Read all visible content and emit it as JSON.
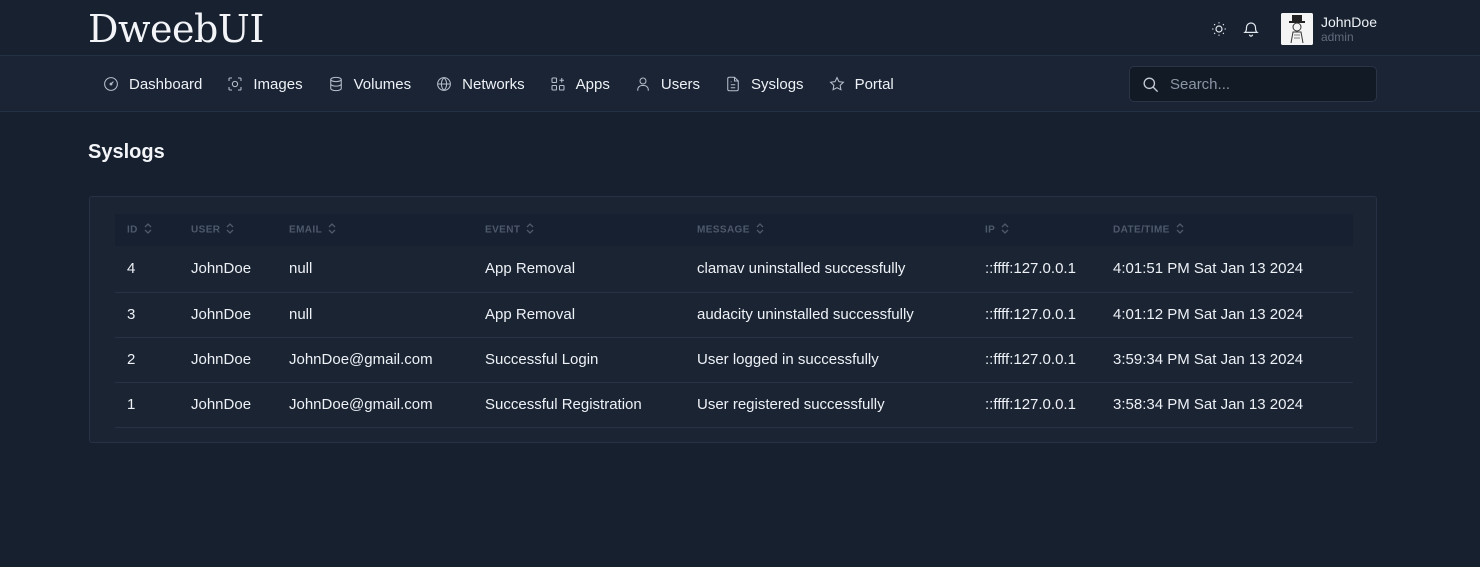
{
  "app": {
    "title": "DweebUI"
  },
  "user": {
    "name": "JohnDoe",
    "role": "admin"
  },
  "nav": {
    "items": [
      {
        "label": "Dashboard",
        "icon": "gauge-icon"
      },
      {
        "label": "Images",
        "icon": "image-scan-icon"
      },
      {
        "label": "Volumes",
        "icon": "database-icon"
      },
      {
        "label": "Networks",
        "icon": "globe-icon"
      },
      {
        "label": "Apps",
        "icon": "apps-plus-icon"
      },
      {
        "label": "Users",
        "icon": "user-icon"
      },
      {
        "label": "Syslogs",
        "icon": "file-text-icon"
      },
      {
        "label": "Portal",
        "icon": "star-icon"
      }
    ]
  },
  "search": {
    "placeholder": "Search..."
  },
  "page": {
    "title": "Syslogs"
  },
  "table": {
    "columns": [
      "ID",
      "USER",
      "EMAIL",
      "EVENT",
      "MESSAGE",
      "IP",
      "DATE/TIME"
    ],
    "rows": [
      [
        "4",
        "JohnDoe",
        "null",
        "App Removal",
        "clamav uninstalled successfully",
        "::ffff:127.0.0.1",
        "4:01:51 PM Sat Jan 13 2024"
      ],
      [
        "3",
        "JohnDoe",
        "null",
        "App Removal",
        "audacity uninstalled successfully",
        "::ffff:127.0.0.1",
        "4:01:12 PM Sat Jan 13 2024"
      ],
      [
        "2",
        "JohnDoe",
        "JohnDoe@gmail.com",
        "Successful Login",
        "User logged in successfully",
        "::ffff:127.0.0.1",
        "3:59:34 PM Sat Jan 13 2024"
      ],
      [
        "1",
        "JohnDoe",
        "JohnDoe@gmail.com",
        "Successful Registration",
        "User registered successfully",
        "::ffff:127.0.0.1",
        "3:58:34 PM Sat Jan 13 2024"
      ]
    ]
  },
  "colors": {
    "background": "#17202f",
    "card": "#1a2433",
    "text": "#eef1f6",
    "muted": "#4e5a6c"
  }
}
